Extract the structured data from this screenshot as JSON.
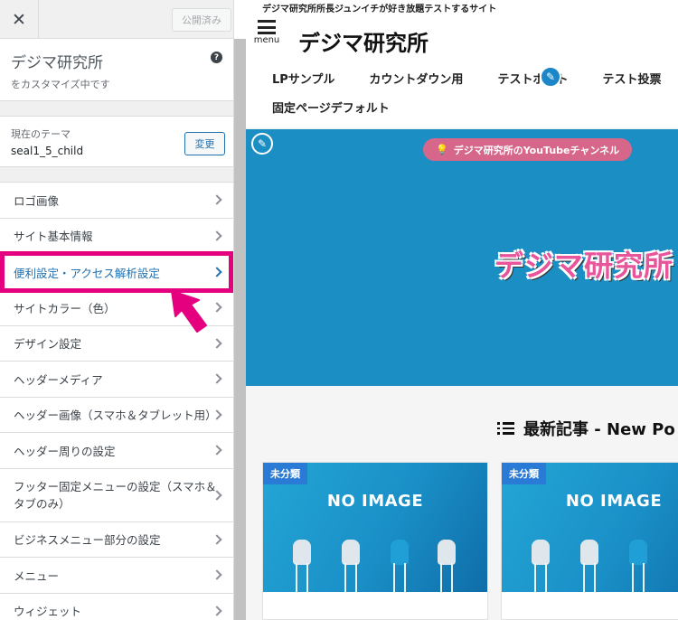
{
  "panel": {
    "close_icon": "close-icon",
    "publish_label": "公開済み",
    "site_title": "デジマ研究所",
    "site_sub": "をカスタマイズ中です",
    "help_icon": "help-icon",
    "theme_label": "現在のテーマ",
    "theme_name": "seal1_5_child",
    "change_label": "変更",
    "sections": [
      {
        "label": "ロゴ画像"
      },
      {
        "label": "サイト基本情報"
      },
      {
        "label": "便利設定・アクセス解析設定",
        "active": true
      },
      {
        "label": "サイトカラー（色）"
      },
      {
        "label": "デザイン設定"
      },
      {
        "label": "ヘッダーメディア"
      },
      {
        "label": "ヘッダー画像（スマホ＆タブレット用）"
      },
      {
        "label": "ヘッダー周りの設定"
      },
      {
        "label_line1": "フッター固定メニューの設定（スマホ＆",
        "label_line2": "タブのみ）"
      },
      {
        "label": "ビジネスメニュー部分の設定"
      },
      {
        "label": "メニュー"
      },
      {
        "label": "ウィジェット"
      }
    ]
  },
  "preview": {
    "tagline": "デジマ研究所所長ジュンイチが好き放題テストするサイト",
    "menu_label": "menu",
    "brand": "デジマ研究所",
    "nav": [
      "LPサンプル",
      "カウントダウン用",
      "テストポスト",
      "テスト投票"
    ],
    "nav2": "固定ページデフォルト",
    "notice": "デジマ研究所のYouTubeチャンネル",
    "hero_logo": "デジマ研究所",
    "latest_heading": "最新記事 - New Po",
    "cards": [
      {
        "category": "未分類",
        "noimage": "NO IMAGE"
      },
      {
        "category": "未分類",
        "noimage": "NO IMAGE"
      }
    ]
  },
  "colors": {
    "accent": "#2271b1",
    "highlight": "#e4007f",
    "hero_bg": "#1b8fc4",
    "notice_bg": "#d6678b"
  }
}
